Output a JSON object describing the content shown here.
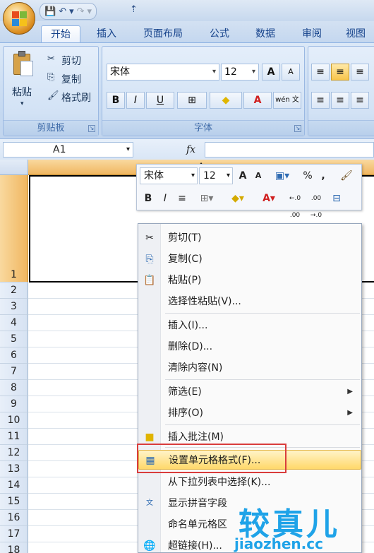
{
  "qat": {
    "save": "💾",
    "undo": "↶",
    "undo_drop": "▾",
    "redo": "↷",
    "redo_drop": "▾",
    "customize": "⇡"
  },
  "tabs": [
    "开始",
    "插入",
    "页面布局",
    "公式",
    "数据",
    "审阅",
    "视图"
  ],
  "clipboard": {
    "paste": "粘贴",
    "paste_arrow": "▾",
    "cut": "剪切",
    "copy": "复制",
    "format_painter": "格式刷",
    "group": "剪贴板"
  },
  "font_group": {
    "font_name": "宋体",
    "font_size": "12",
    "grow": "A",
    "shrink": "A",
    "bold": "B",
    "italic": "I",
    "underline": "U",
    "border": "⊞",
    "fill": "◆",
    "color": "A",
    "phonetic": "wén 文",
    "group": "字体"
  },
  "formula_bar": {
    "cell_ref": "A1",
    "fx": "fx"
  },
  "grid": {
    "column_a": "A",
    "rows": [
      "1",
      "2",
      "3",
      "4",
      "5",
      "6",
      "7",
      "8",
      "9",
      "10",
      "11",
      "12",
      "13",
      "14",
      "15",
      "16",
      "17",
      "18"
    ]
  },
  "mini_toolbar": {
    "font_name": "宋体",
    "font_size": "12",
    "grow": "A",
    "shrink": "A",
    "percent": "%",
    "comma": ",",
    "bold": "B",
    "italic": "I",
    "align": "≡",
    "inc_dec": "←.0 .00",
    "dec_dec": ".00 →.0"
  },
  "context_menu": {
    "items": [
      {
        "label": "剪切(T)"
      },
      {
        "label": "复制(C)"
      },
      {
        "label": "粘贴(P)"
      },
      {
        "label": "选择性粘贴(V)..."
      },
      {
        "label": "插入(I)..."
      },
      {
        "label": "删除(D)..."
      },
      {
        "label": "清除内容(N)"
      },
      {
        "label": "筛选(E)"
      },
      {
        "label": "排序(O)"
      },
      {
        "label": "插入批注(M)"
      },
      {
        "label": "设置单元格格式(F)..."
      },
      {
        "label": "从下拉列表中选择(K)..."
      },
      {
        "label": "显示拼音字段"
      },
      {
        "label": "命名单元格区"
      },
      {
        "label": "超链接(H)..."
      }
    ]
  },
  "watermark": {
    "big": "较真儿",
    "small": "jiaozhen.cc"
  }
}
